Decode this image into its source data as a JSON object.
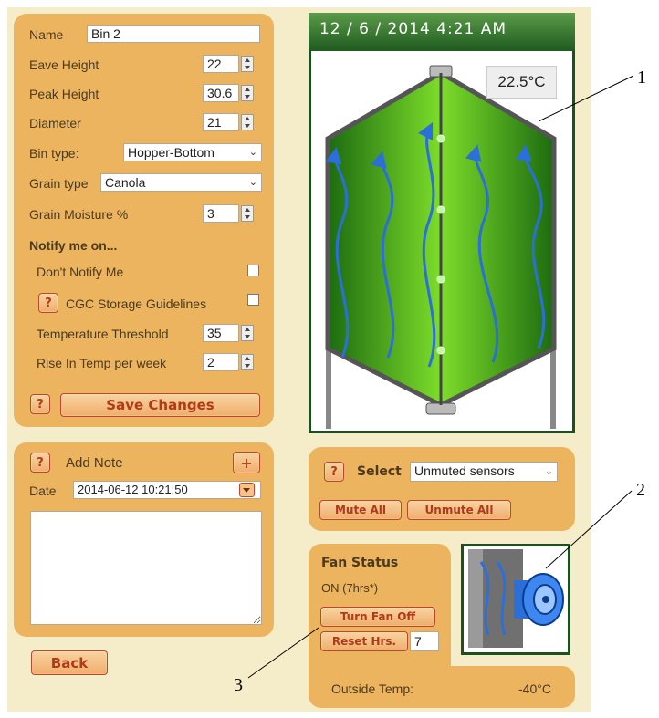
{
  "settings": {
    "name_label": "Name",
    "name_value": "Bin 2",
    "eave_label": "Eave Height",
    "eave_value": "22",
    "peak_label": "Peak Height",
    "peak_value": "30.6",
    "diameter_label": "Diameter",
    "diameter_value": "21",
    "bintype_label": "Bin type:",
    "bintype_value": "Hopper-Bottom",
    "graintype_label": "Grain type",
    "graintype_value": "Canola",
    "moisture_label": "Grain Moisture %",
    "moisture_value": "3",
    "notify_heading": "Notify me on...",
    "dont_notify_label": "Don't Notify Me",
    "cgc_label": "CGC Storage Guidelines",
    "temp_threshold_label": "Temperature Threshold",
    "temp_threshold_value": "35",
    "rise_label": "Rise In Temp per week",
    "rise_value": "2",
    "help_label": "?",
    "save_label": "Save Changes"
  },
  "note": {
    "help_label": "?",
    "title": "Add Note",
    "add_label": "+",
    "date_label": "Date",
    "date_value": "2014-06-12 10:21:50"
  },
  "back_label": "Back",
  "bin_view": {
    "datetime": "12 / 6 / 2014 4:21 AM",
    "temperature": "22.5°C"
  },
  "sensors": {
    "help_label": "?",
    "select_label": "Select",
    "select_value": "Unmuted sensors",
    "mute_all": "Mute All",
    "unmute_all": "Unmute All"
  },
  "fan": {
    "title": "Fan Status",
    "status": "ON (7hrs*)",
    "turn_off": "Turn Fan Off",
    "reset": "Reset Hrs.",
    "hours_value": "7",
    "outside_label": "Outside Temp:",
    "outside_value": "-40°C"
  },
  "annotations": {
    "a1": "1",
    "a2": "2",
    "a3": "3"
  },
  "colors": {
    "panel": "#ecb45f",
    "button_text": "#b03a1a",
    "header_green": "#2e6b2e",
    "bin_green": "#4cae1e"
  },
  "icons": [
    "help-icon",
    "plus-icon",
    "dropdown-arrow-icon",
    "spinner-icon",
    "fan-icon",
    "airflow-arrow-icon"
  ]
}
